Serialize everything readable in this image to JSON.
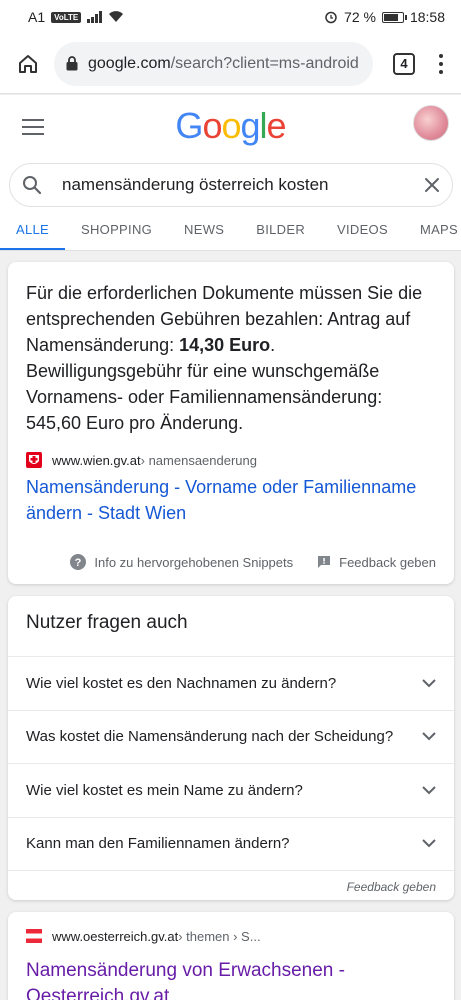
{
  "status_bar": {
    "carrier": "A1",
    "volte": "VoLTE",
    "battery_percent": "72 %",
    "battery_level": 0.72,
    "time": "18:58"
  },
  "address_bar": {
    "url_host": "google.com",
    "url_path": "/search?client=ms-android",
    "tab_count": "4"
  },
  "google": {
    "logo": "Google",
    "logo_colors": [
      "#4285F4",
      "#EA4335",
      "#FBBC05",
      "#4285F4",
      "#34A853",
      "#EA4335"
    ]
  },
  "search": {
    "query": "namensänderung österreich kosten"
  },
  "tabs": [
    {
      "label": "ALLE",
      "active": true
    },
    {
      "label": "SHOPPING",
      "active": false
    },
    {
      "label": "NEWS",
      "active": false
    },
    {
      "label": "BILDER",
      "active": false
    },
    {
      "label": "VIDEOS",
      "active": false
    },
    {
      "label": "MAPS",
      "active": false
    }
  ],
  "featured_snippet": {
    "text_part1": "Für die erforderlichen Dokumente müssen Sie die entsprechenden Gebühren bezahlen: Antrag auf Namensänderung: ",
    "text_bold": "14,30 Euro",
    "text_part2": ". Bewilligungsgebühr für eine wunschgemäße Vornamens- oder Familiennamensänderung: 545,60 Euro pro Änderung.",
    "source_domain": "www.wien.gv.at",
    "source_path": " › namensaenderung",
    "title": "Namensänderung - Vorname oder Familienname ändern - Stadt Wien",
    "info_label": "Info zu hervorgehobenen Snippets",
    "feedback_label": "Feedback geben"
  },
  "people_also_ask": {
    "title": "Nutzer fragen auch",
    "questions": [
      "Wie viel kostet es den Nachnamen zu ändern?",
      "Was kostet die Namensänderung nach der Scheidung?",
      "Wie viel kostet es mein Name zu ändern?",
      "Kann man den Familiennamen ändern?"
    ],
    "feedback_label": "Feedback geben"
  },
  "result2": {
    "source_domain": "www.oesterreich.gv.at",
    "source_path": " › themen › S...",
    "title": "Namensänderung von Erwachsenen - Oesterreich.gv.at"
  }
}
